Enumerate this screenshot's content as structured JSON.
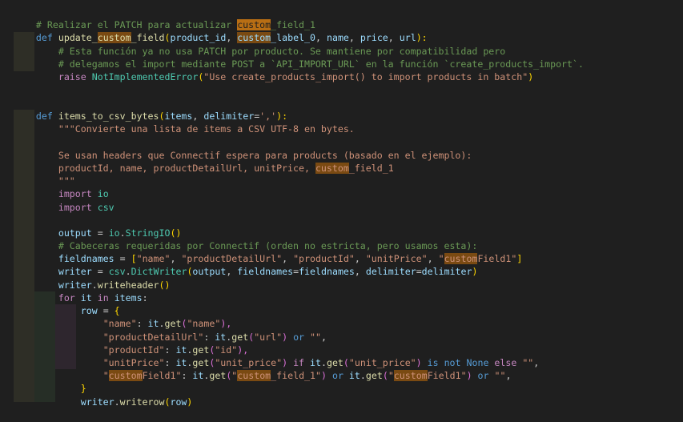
{
  "code": {
    "l1_comment_prefix": "# Realizar el PATCH para actualizar ",
    "l1_highlight": "custom",
    "l1_suffix": "_field_1",
    "l2_def": "def",
    "l2_fn_a": "update_",
    "l2_fn_hl": "custom",
    "l2_fn_b": "_field",
    "l2_open": "(",
    "l2_p1": "product_id",
    "l2_sep": ", ",
    "l2_p2_hl": "custom",
    "l2_p2": "_label_0",
    "l2_p3": "name",
    "l2_p4": "price",
    "l2_p5": "url",
    "l2_close": "):",
    "l3_comment": "# Esta función ya no usa PATCH por producto. Se mantiene por compatibilidad pero",
    "l4_comment": "# delegamos el import mediante POST a `API_IMPORT_URL` en la función `create_products_import`.",
    "l5_raise": "raise",
    "l5_cls": "NotImplementedError",
    "l5_open": "(",
    "l5_str": "\"Use create_products_import() to import products in batch\"",
    "l5_close": ")",
    "l8_def": "def",
    "l8_fn": "items_to_csv_bytes",
    "l8_open": "(",
    "l8_p1": "items",
    "l8_sep": ", ",
    "l8_p2": "delimiter",
    "l8_eq": "=",
    "l8_str": "','",
    "l8_close": "):",
    "l9_doc": "\"\"\"Convierte una lista de items a CSV UTF-8 en bytes.",
    "l11_doc": "Se usan headers que Connectif espera para products (basado en el ejemplo):",
    "l12_doc_a": "productId, name, productDetailUrl, unitPrice, ",
    "l12_doc_hl": "custom",
    "l12_doc_b": "_field_1",
    "l13_doc": "\"\"\"",
    "l14_import": "import",
    "l14_mod": "io",
    "l15_import": "import",
    "l15_mod": "csv",
    "l17_var": "output",
    "l17_eq": " = ",
    "l17_mod": "io",
    "l17_dot": ".",
    "l17_cls": "StringIO",
    "l17_paren": "()",
    "l18_comment": "# Cabeceras requeridas por Connectif (orden no estricta, pero usamos esta):",
    "l19_var": "fieldnames",
    "l19_eq": " = ",
    "l19_open": "[",
    "l19_s1": "\"name\"",
    "l19_c": ", ",
    "l19_s2": "\"productDetailUrl\"",
    "l19_s3": "\"productId\"",
    "l19_s4": "\"unitPrice\"",
    "l19_s5a": "\"",
    "l19_s5hl": "custom",
    "l19_s5b": "Field1\"",
    "l19_close": "]",
    "l20_var": "writer",
    "l20_eq": " = ",
    "l20_mod": "csv",
    "l20_dot": ".",
    "l20_cls": "DictWriter",
    "l20_open": "(",
    "l20_a1": "output",
    "l20_c": ", ",
    "l20_a2": "fieldnames",
    "l20_eq2": "=",
    "l20_a3": "fieldnames",
    "l20_a4": "delimiter",
    "l20_a5": "delimiter",
    "l20_close": ")",
    "l21_var": "writer",
    "l21_dot": ".",
    "l21_fn": "writeheader",
    "l21_paren": "()",
    "l22_for": "for",
    "l22_v": "it",
    "l22_in": "in",
    "l22_items": "items",
    "l22_colon": ":",
    "l23_var": "row",
    "l23_eq": " = ",
    "l23_open": "{",
    "l24_s": "\"name\"",
    "l24_colon": ": ",
    "l24_v": "it",
    "l24_dot": ".",
    "l24_fn": "get",
    "l24_open": "(",
    "l24_arg": "\"name\"",
    "l24_close": "),",
    "l25_s": "\"productDetailUrl\"",
    "l25_colon": ": ",
    "l25_v": "it",
    "l25_dot": ".",
    "l25_fn": "get",
    "l25_open": "(",
    "l25_arg": "\"url\"",
    "l25_close": ") ",
    "l25_or": "or",
    "l25_empty": " \"\"",
    "l25_end": ",",
    "l26_s": "\"productId\"",
    "l26_colon": ": ",
    "l26_v": "it",
    "l26_dot": ".",
    "l26_fn": "get",
    "l26_open": "(",
    "l26_arg": "\"id\"",
    "l26_close": "),",
    "l27_s": "\"unitPrice\"",
    "l27_colon": ": ",
    "l27_v": "it",
    "l27_dot": ".",
    "l27_fn": "get",
    "l27_open": "(",
    "l27_arg": "\"unit_price\"",
    "l27_close": ") ",
    "l27_if": "if",
    "l27_arg2": "\"unit_price\"",
    "l27_isnot": "is not",
    "l27_none": "None",
    "l27_else": "else",
    "l27_empty": "\"\"",
    "l27_end": ",",
    "l28_s_a": "\"",
    "l28_s_hl": "custom",
    "l28_s_b": "Field1\"",
    "l28_colon": ": ",
    "l28_v": "it",
    "l28_dot": ".",
    "l28_fn": "get",
    "l28_open": "(",
    "l28_arg_a": "\"",
    "l28_arg_hl": "custom",
    "l28_arg_b": "_field_1\"",
    "l28_close": ") ",
    "l28_or": "or",
    "l28_arg2_a": "\"",
    "l28_arg2_hl": "custom",
    "l28_arg2_b": "Field1\"",
    "l28_or2": "or",
    "l28_empty": "\"\"",
    "l28_end": ",",
    "l29_close": "}",
    "l30_var": "writer",
    "l30_dot": ".",
    "l30_fn": "writerow",
    "l30_open": "(",
    "l30_arg": "row",
    "l30_close": ")"
  }
}
